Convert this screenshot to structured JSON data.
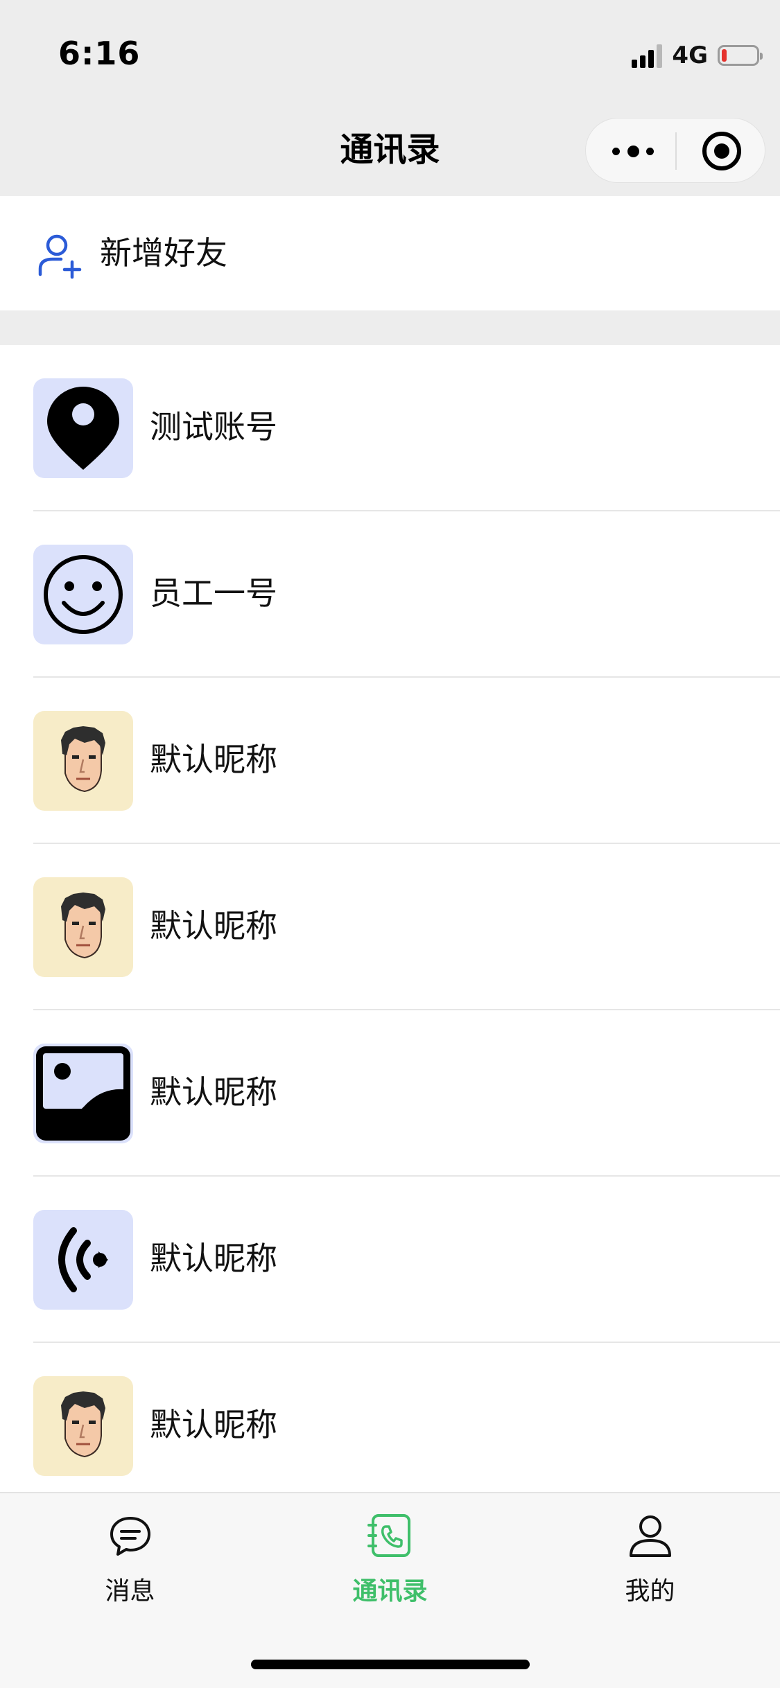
{
  "status_bar": {
    "time": "6:16",
    "network": "4G",
    "battery_level": 0.15,
    "battery_color": "#e5322d"
  },
  "nav": {
    "title": "通讯录",
    "more_icon": "more-dots-icon",
    "close_icon": "capsule-close-icon"
  },
  "add_friend": {
    "icon": "add-user-icon",
    "icon_color": "#2b5bd7",
    "label": "新增好友"
  },
  "contacts": [
    {
      "name": "测试账号",
      "avatar": "location-pin-icon",
      "avatar_bg": "#dbe1fb"
    },
    {
      "name": "员工一号",
      "avatar": "smiley-face-icon",
      "avatar_bg": "#dbe1fb"
    },
    {
      "name": "默认昵称",
      "avatar": "cartoon-face-avatar",
      "avatar_bg": "#f7ecc8"
    },
    {
      "name": "默认昵称",
      "avatar": "cartoon-face-avatar",
      "avatar_bg": "#f7ecc8"
    },
    {
      "name": "默认昵称",
      "avatar": "image-placeholder-icon",
      "avatar_bg": "#dbe1fb"
    },
    {
      "name": "默认昵称",
      "avatar": "broadcast-signal-icon",
      "avatar_bg": "#dbe1fb"
    },
    {
      "name": "默认昵称",
      "avatar": "cartoon-face-avatar",
      "avatar_bg": "#f7ecc8"
    }
  ],
  "tabbar": {
    "active_color": "#3fbf6a",
    "tabs": [
      {
        "label": "消息",
        "icon": "chat-bubble-icon",
        "active": false
      },
      {
        "label": "通讯录",
        "icon": "phone-book-icon",
        "active": true
      },
      {
        "label": "我的",
        "icon": "user-profile-icon",
        "active": false
      }
    ]
  }
}
